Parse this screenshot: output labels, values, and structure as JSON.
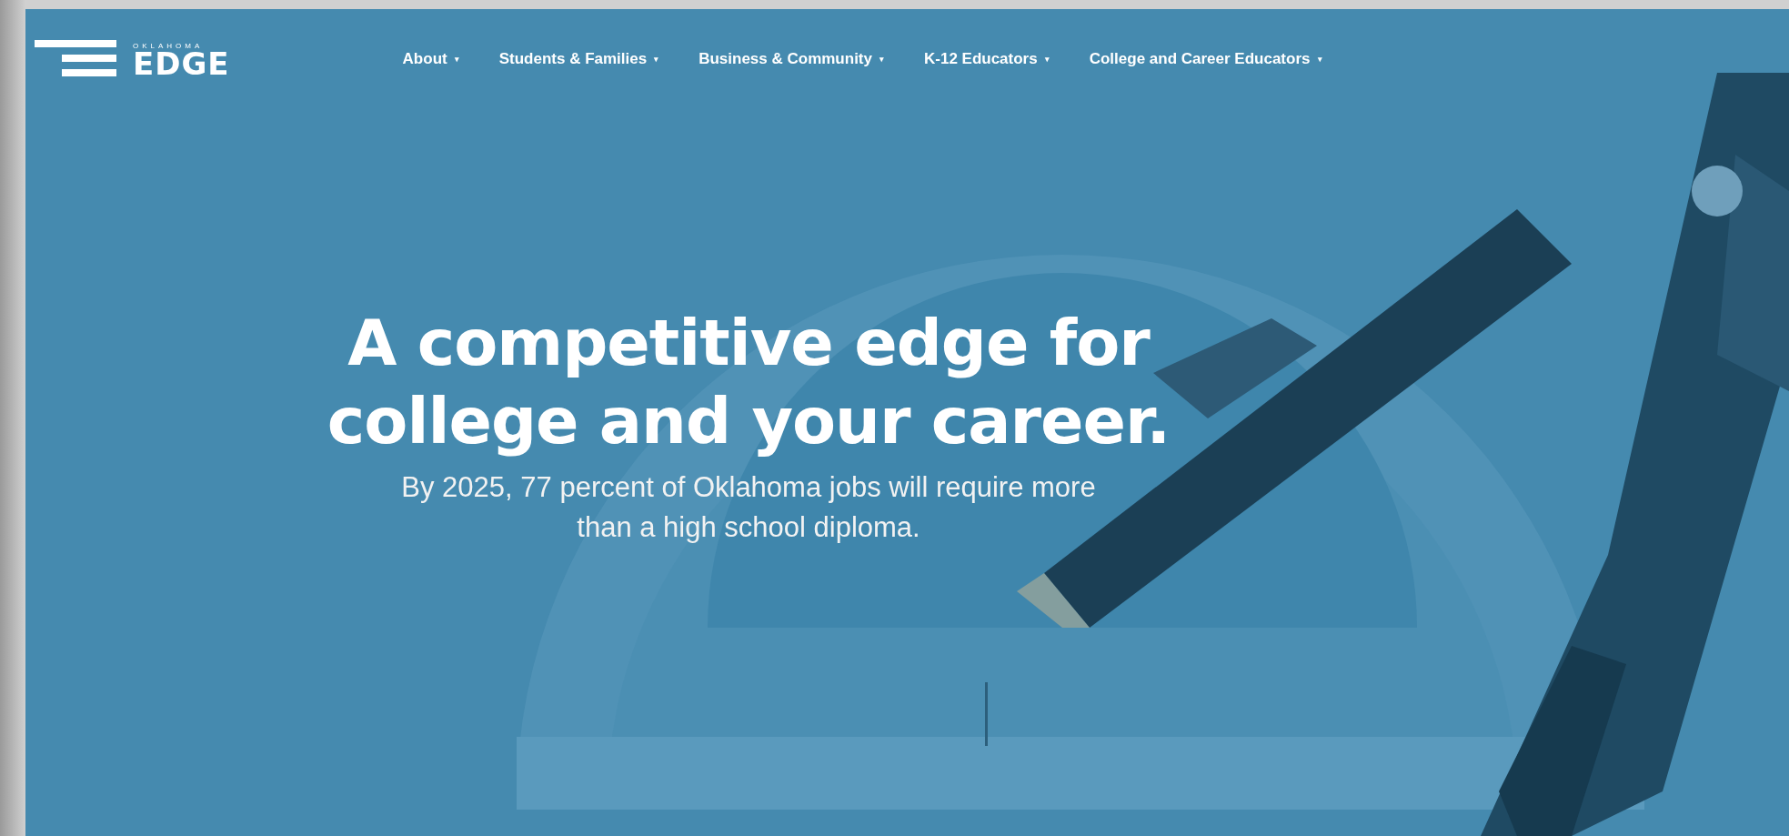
{
  "logo": {
    "small_text": "OKLAHOMA",
    "wordmark": "EDGE"
  },
  "nav": [
    {
      "label": "About",
      "caret": "▾"
    },
    {
      "label": "Students & Families",
      "caret": "▾"
    },
    {
      "label": "Business & Community",
      "caret": "▾"
    },
    {
      "label": "K-12 Educators",
      "caret": "▾"
    },
    {
      "label": "College and Career Educators",
      "caret": "▾"
    }
  ],
  "hero": {
    "headline": "A competitive edge for college and your career.",
    "subtitle": "By 2025, 77 percent of Oklahoma jobs will require more than a high school diploma."
  }
}
